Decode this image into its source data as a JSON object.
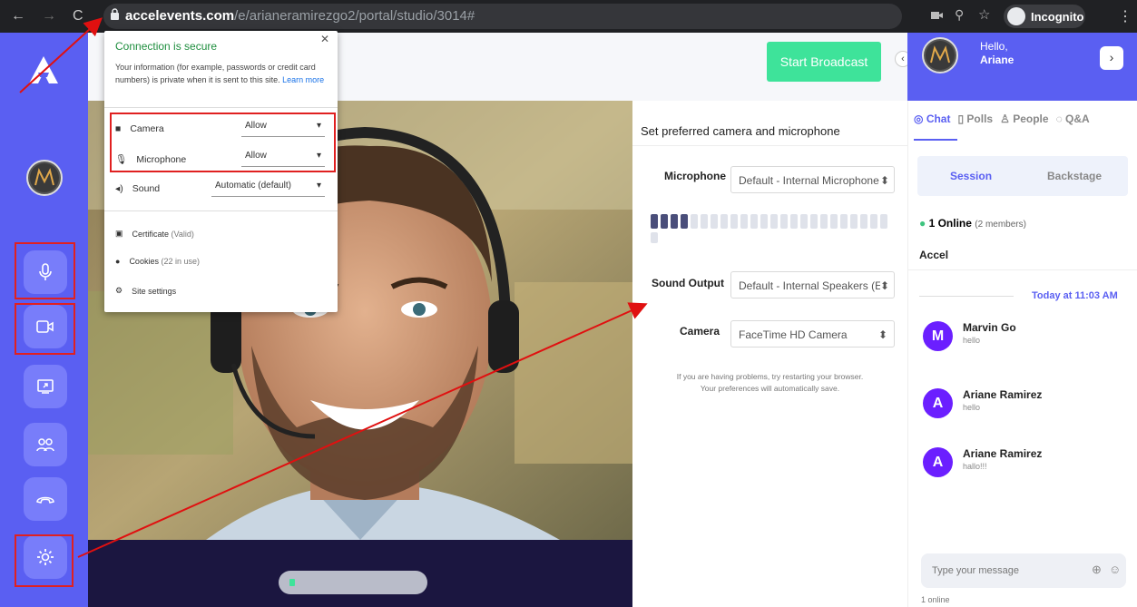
{
  "browser": {
    "url_domain": "accelevents.com",
    "url_path": "/e/arianeramirezgo2/portal/studio/3014#",
    "incognito_label": "Incognito"
  },
  "header": {
    "start_broadcast": "Start Broadcast",
    "greeting_line1": "Hello,",
    "greeting_line2": "Ariane"
  },
  "site_popup": {
    "title": "Connection is secure",
    "description": "Your information (for example, passwords or credit card numbers) is private when it is sent to this site.",
    "learn_more": "Learn more",
    "permissions": [
      {
        "label": "Camera",
        "value": "Allow",
        "icon": "camera-icon"
      },
      {
        "label": "Microphone",
        "value": "Allow",
        "icon": "microphone-icon"
      },
      {
        "label": "Sound",
        "value": "Automatic (default)",
        "icon": "speaker-icon"
      }
    ],
    "links": [
      {
        "label": "Certificate",
        "note": "(Valid)",
        "icon": "certificate-icon"
      },
      {
        "label": "Cookies",
        "note": "(22 in use)",
        "icon": "cookie-icon"
      },
      {
        "label": "Site settings",
        "note": "",
        "icon": "gear-icon"
      }
    ]
  },
  "device_settings": {
    "title": "Set preferred camera and microphone",
    "microphone_label": "Microphone",
    "microphone_value": "Default - Internal Microphone",
    "sound_output_label": "Sound Output",
    "sound_output_value": "Default - Internal Speakers (E",
    "camera_label": "Camera",
    "camera_value": "FaceTime HD Camera",
    "help_line1": "If you are having problems, try restarting your browser.",
    "help_line2": "Your preferences will automatically save.",
    "mic_level_filled": 4,
    "mic_level_total": 24
  },
  "right_panel": {
    "tabs": [
      "Chat",
      "Polls",
      "People",
      "Q&A"
    ],
    "subtabs": [
      "Session",
      "Backstage"
    ],
    "online_count": "1 Online",
    "online_members": "(2 members)",
    "group_name": "Accel",
    "date_divider": "Today at 11:03 AM",
    "messages": [
      {
        "initial": "M",
        "name": "Marvin Go",
        "text": "hello"
      },
      {
        "initial": "A",
        "name": "Ariane Ramirez",
        "text": "hello"
      },
      {
        "initial": "A",
        "name": "Ariane Ramirez",
        "text": "hallo!!!"
      }
    ],
    "input_placeholder": "Type your message",
    "footer": "1 online"
  },
  "sidebar": {
    "buttons": [
      "microphone-icon",
      "camera-icon",
      "screen-share-icon",
      "people-icon",
      "hang-up-icon",
      "settings-icon"
    ]
  },
  "colors": {
    "brand": "#5a5ff2",
    "accent": "#3ee39a",
    "annotation": "#e02020"
  }
}
